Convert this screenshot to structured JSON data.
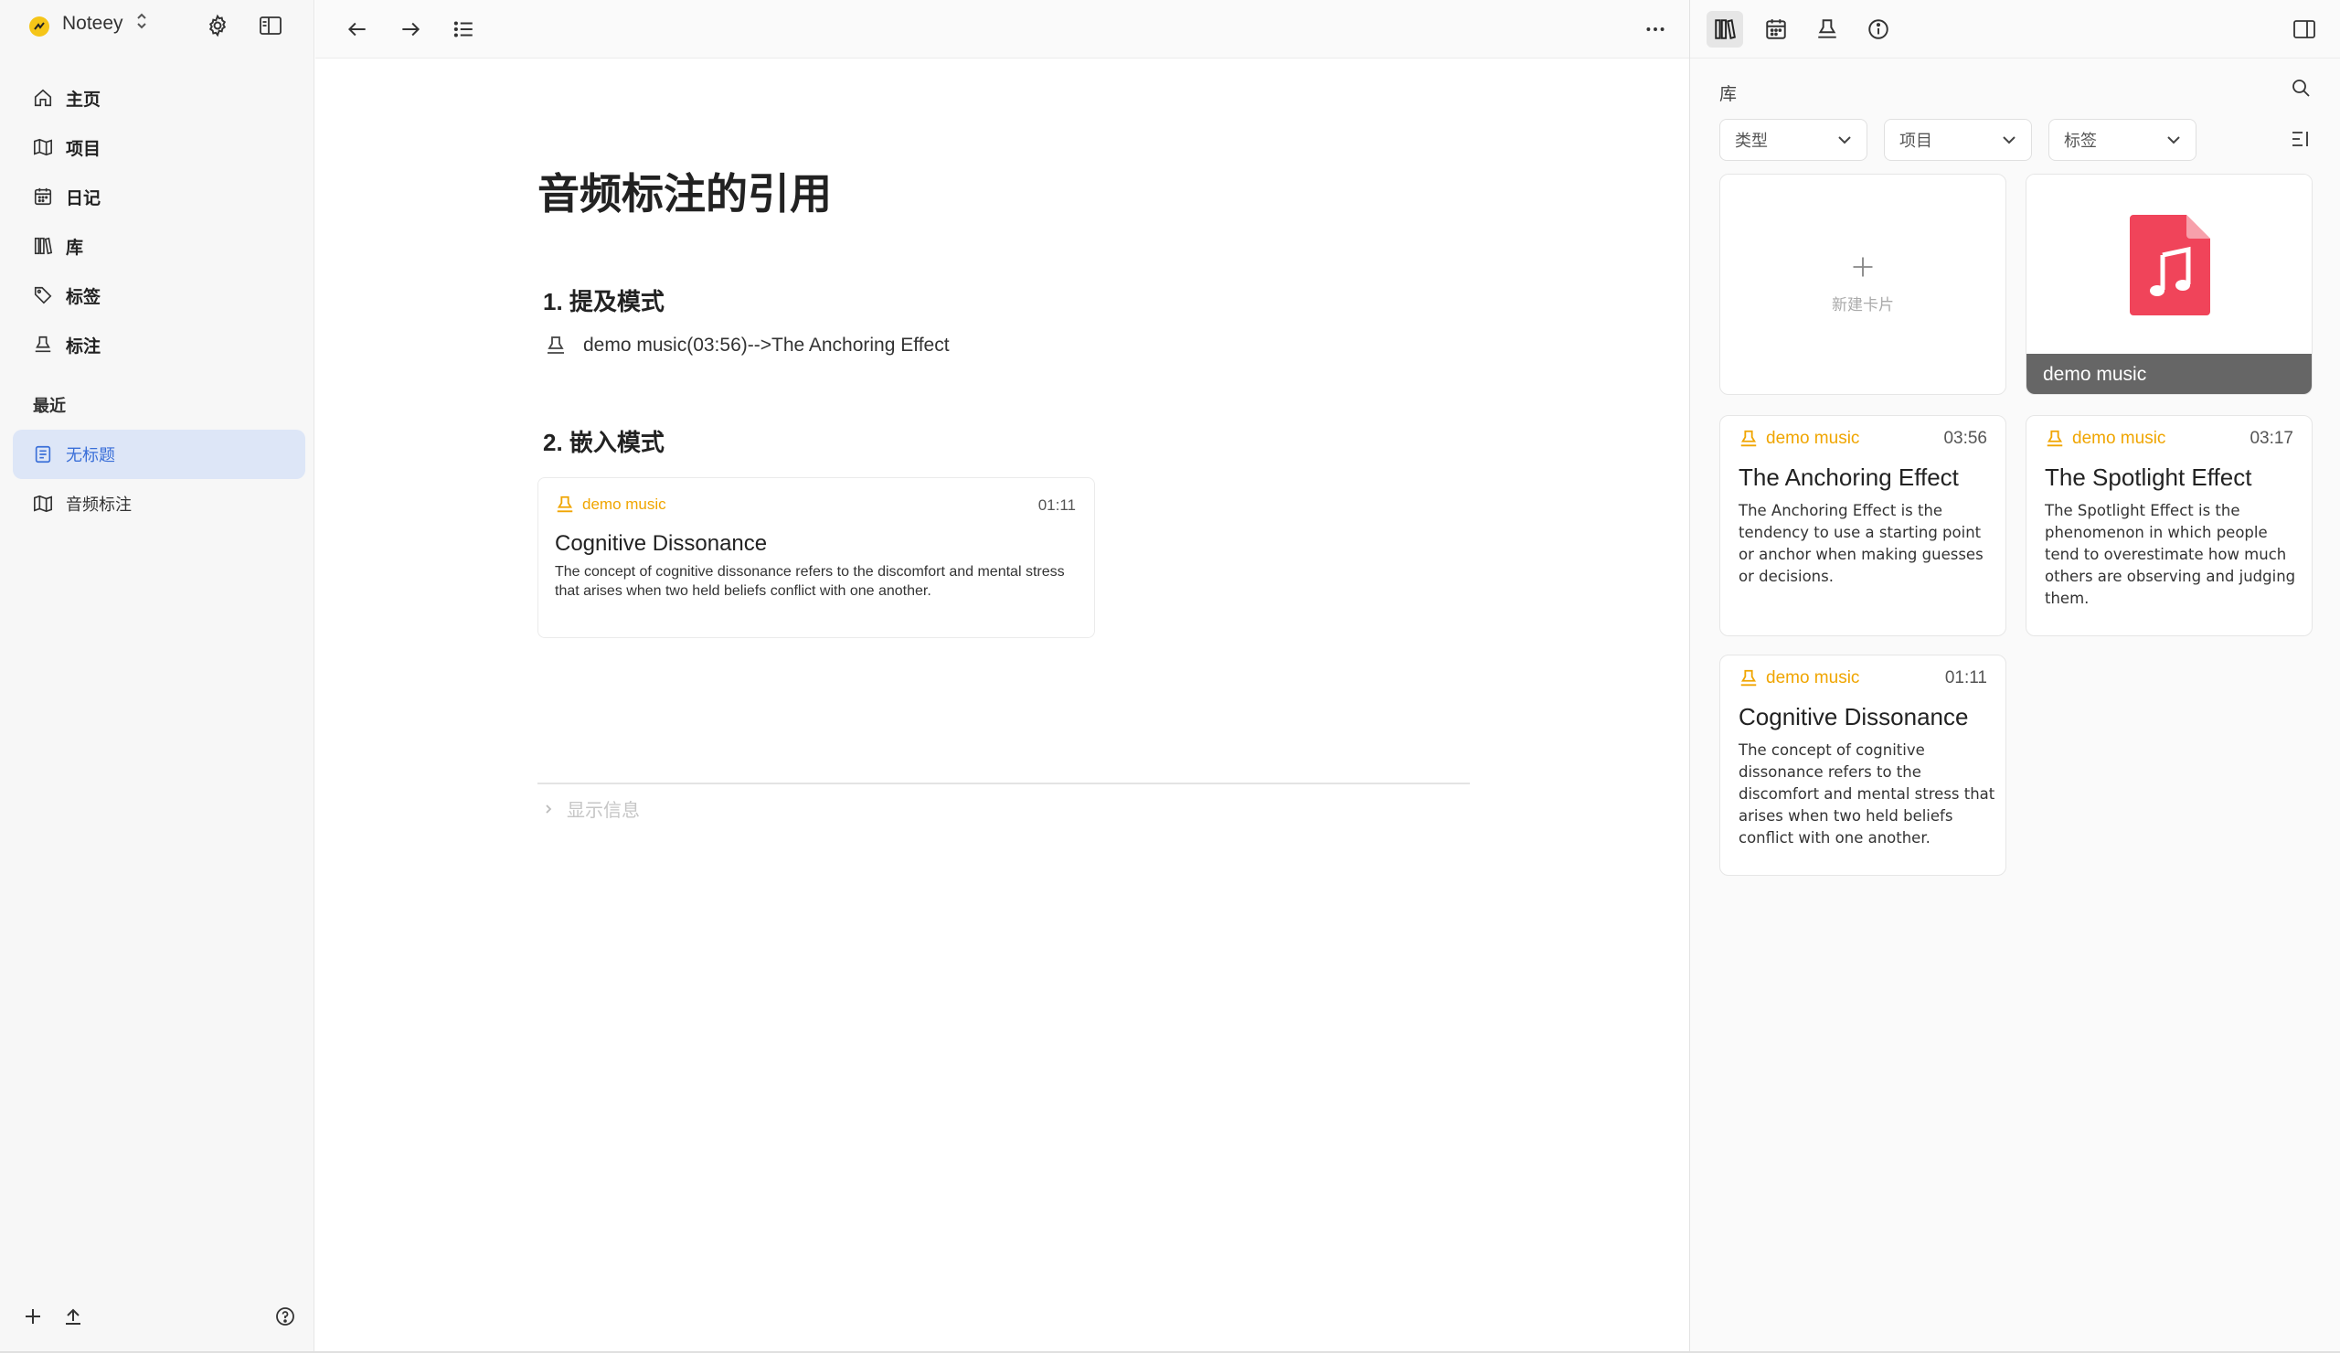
{
  "app": {
    "name": "Noteey"
  },
  "sidebar": {
    "nav": [
      {
        "label": "主页",
        "icon": "home-icon"
      },
      {
        "label": "项目",
        "icon": "map-icon"
      },
      {
        "label": "日记",
        "icon": "calendar-icon"
      },
      {
        "label": "库",
        "icon": "library-icon"
      },
      {
        "label": "标签",
        "icon": "tag-icon"
      },
      {
        "label": "标注",
        "icon": "highlighter-icon"
      }
    ],
    "recent_title": "最近",
    "recent": [
      {
        "label": "无标题",
        "icon": "document-icon",
        "active": true
      },
      {
        "label": "音频标注",
        "icon": "map-icon",
        "active": false
      }
    ]
  },
  "document": {
    "title": "音频标注的引用",
    "section1": "1. 提及模式",
    "mention_text": "demo music(03:56)-->The Anchoring Effect",
    "section2": "2. 嵌入模式",
    "embed": {
      "source": "demo music",
      "time": "01:11",
      "title": "Cognitive Dissonance",
      "desc": "The concept of cognitive dissonance refers to the discomfort and mental stress that arises when two held beliefs conflict with one another."
    },
    "show_info": "显示信息"
  },
  "library": {
    "title": "库",
    "filters": [
      "类型",
      "项目",
      "标签"
    ],
    "new_card_label": "新建卡片",
    "music_card_title": "demo music",
    "cards": [
      {
        "source": "demo music",
        "time": "03:56",
        "title": "The Anchoring Effect",
        "desc": "The Anchoring Effect is the tendency to use a starting point or anchor when making guesses or decisions."
      },
      {
        "source": "demo music",
        "time": "03:17",
        "title": "The Spotlight Effect",
        "desc": "The Spotlight Effect is the phenomenon in which people tend to overestimate how much others are observing and judging them."
      },
      {
        "source": "demo music",
        "time": "01:11",
        "title": "Cognitive Dissonance",
        "desc": "The concept of cognitive dissonance refers to the discomfort and mental stress that arises when two held beliefs conflict with one another."
      }
    ]
  },
  "colors": {
    "accent": "#3a6fd8",
    "annotation": "#f0a500",
    "music": "#f0445a"
  }
}
